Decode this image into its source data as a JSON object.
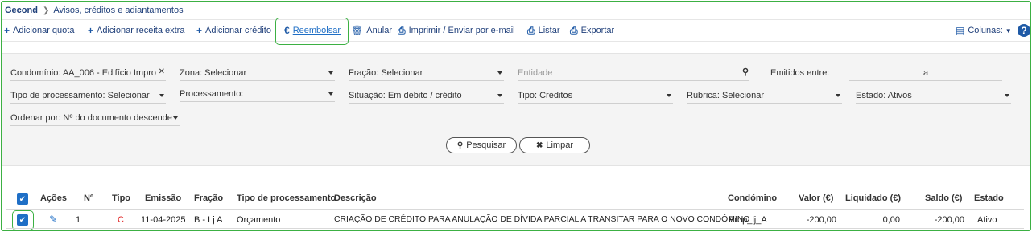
{
  "breadcrumb": {
    "root": "Gecond",
    "page": "Avisos, créditos e adiantamentos"
  },
  "toolbar": {
    "add_quota": "Adicionar quota",
    "add_extra": "Adicionar receita extra",
    "add_credit": "Adicionar crédito",
    "refund": "Reembolsar",
    "cancel": "Anular",
    "print": "Imprimir / Enviar por e-mail",
    "list": "Listar",
    "export": "Exportar",
    "columns": "Colunas:",
    "help": "?"
  },
  "filters": {
    "condominio": "Condomínio: AA_006 - Edifício Impro",
    "zona": "Zona: Selecionar",
    "fracao": "Fração: Selecionar",
    "entidade_placeholder": "Entidade",
    "emitidos_label": "Emitidos entre:",
    "emitidos_a": "a",
    "tipo_processamento": "Tipo de processamento: Selecionar",
    "processamento": "Processamento:",
    "situacao": "Situação: Em débito / crédito",
    "tipo": "Tipo: Créditos",
    "rubrica": "Rubrica: Selecionar",
    "estado": "Estado: Ativos",
    "ordenar": "Ordenar por: Nº do documento descende"
  },
  "buttons": {
    "search": "Pesquisar",
    "clear": "Limpar"
  },
  "table": {
    "headers": {
      "acoes": "Ações",
      "num": "Nº",
      "tipo": "Tipo",
      "emissao": "Emissão",
      "fracao": "Fração",
      "tipo_proc": "Tipo de processamento",
      "descricao": "Descrição",
      "condomino": "Condómino",
      "valor": "Valor (€)",
      "liquidado": "Liquidado (€)",
      "saldo": "Saldo (€)",
      "estado": "Estado"
    },
    "rows": [
      {
        "num": "1",
        "tipo": "C",
        "emissao": "11-04-2025",
        "fracao": "B - Lj A",
        "tipo_proc": "Orçamento",
        "descricao": "CRIAÇÃO DE CRÉDITO PARA ANULAÇÃO DE DÍVIDA PARCIAL A TRANSITAR PARA O NOVO CONDÓMINO",
        "condomino": "Prop_lj_A",
        "valor": "-200,00",
        "liquidado": "0,00",
        "saldo": "-200,00",
        "estado": "Ativo"
      }
    ]
  },
  "colors": {
    "accent": "#1f6fc6",
    "highlight": "#3cb043",
    "type_c": "#e02020"
  }
}
